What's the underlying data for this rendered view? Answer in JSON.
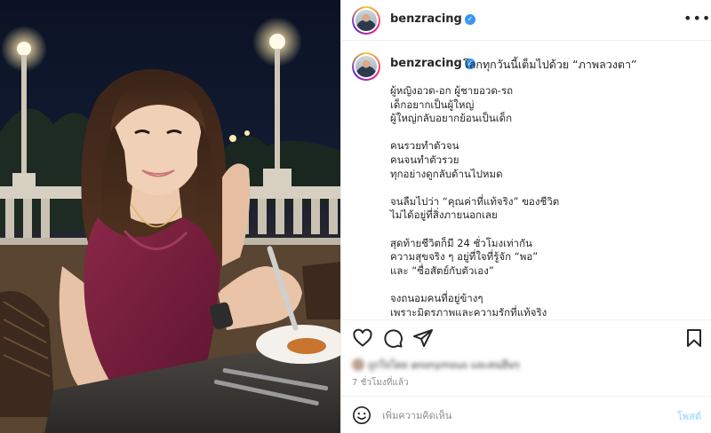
{
  "post": {
    "username": "benzracing",
    "verified": true,
    "more_icon": "ellipsis-icon",
    "caption_first_line": "โลกทุกวันนี้เต็มไปด้วย “ภาพลวงตา”",
    "caption_lines": [
      "ผู้หญิงอวด-อก ผู้ชายอวด-รถ",
      "เด็กอยากเป็นผู้ใหญ่",
      "ผู้ใหญ่กลับอยากย้อนเป็นเด็ก",
      "",
      "คนรวยทำตัวจน",
      "คนจนทำตัวรวย",
      "ทุกอย่างดูกลับด้านไปหมด",
      "",
      "จนลืมไปว่า “คุณค่าที่แท้จริง” ของชีวิต",
      "ไม่ได้อยู่ที่สิ่งภายนอกเลย",
      "",
      "สุดท้ายชีวิตก็มี 24 ชั่วโมงเท่ากัน",
      "ความสุขจริง ๆ อยู่ที่ใจที่รู้จัก “พอ”",
      "และ “ซื่อสัตย์กับตัวเอง”",
      "",
      "จงถนอมคนที่อยู่ข้างๆ",
      "เพราะมิตรภาพและความรักที่แท้จริง"
    ],
    "likes_text": "ถูกใจโดย anonymous และคนอื่นๆ",
    "time_ago": "7 ชั่วโมงที่แล้ว"
  },
  "actions": {
    "like_icon": "heart-icon",
    "comment_icon": "comment-icon",
    "share_icon": "share-icon",
    "save_icon": "bookmark-icon"
  },
  "comment_box": {
    "emoji_icon": "emoji-icon",
    "placeholder": "เพิ่มความคิดเห็น",
    "post_label": "โพสต์"
  },
  "colors": {
    "verified_blue": "#3897f0",
    "post_button": "#b2dffc",
    "dress": "#7a1f3d"
  }
}
